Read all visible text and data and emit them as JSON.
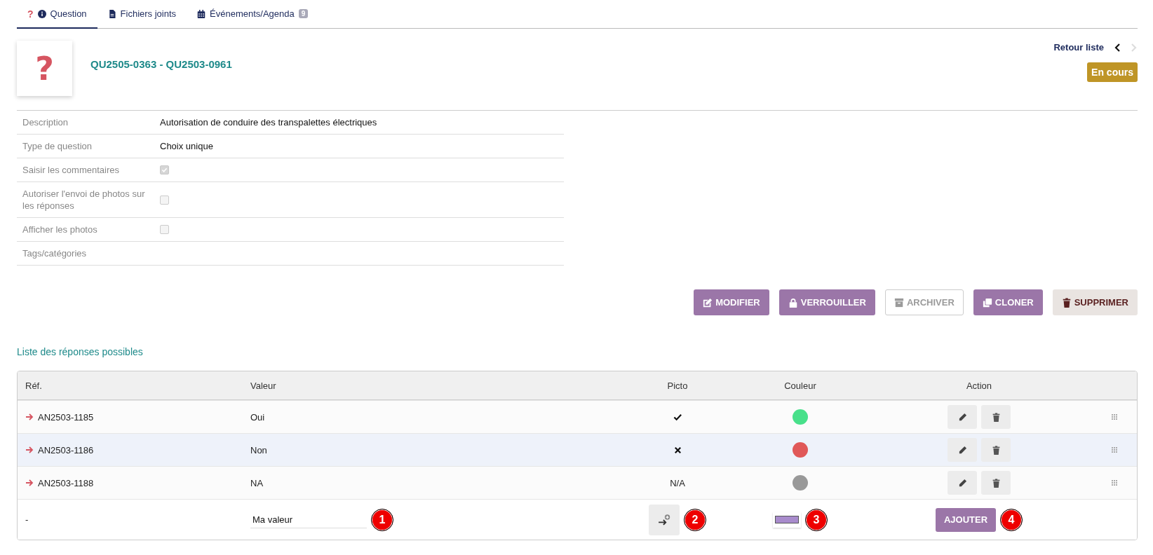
{
  "tabs": [
    {
      "label": "Question",
      "glyph": "?",
      "selected": true
    },
    {
      "label": "Fichiers joints",
      "selected": false
    },
    {
      "label": "Événements/Agenda",
      "badge": "9",
      "selected": false
    }
  ],
  "header": {
    "glyph": "?",
    "title": "QU2505-0363 - QU2503-0961",
    "back_link": "Retour liste",
    "status": "En cours",
    "prev_enabled": true,
    "next_enabled": false
  },
  "properties": [
    {
      "label": "Description",
      "kind": "text",
      "value": "Autorisation de conduire des transpalettes électriques"
    },
    {
      "label": "Type de question",
      "kind": "text",
      "value": "Choix unique"
    },
    {
      "label": "Saisir les commentaires",
      "kind": "checkbox",
      "checked": true
    },
    {
      "label": "Autoriser l'envoi de photos sur les réponses",
      "kind": "checkbox",
      "checked": false
    },
    {
      "label": "Afficher les photos",
      "kind": "checkbox",
      "checked": false
    },
    {
      "label": "Tags/catégories",
      "kind": "text"
    }
  ],
  "actions": [
    {
      "label": "MODIFIER",
      "kind": "primary"
    },
    {
      "label": "VERROUILLER",
      "kind": "primary"
    },
    {
      "label": "ARCHIVER",
      "kind": "disabled"
    },
    {
      "label": "CLONER",
      "kind": "primary"
    },
    {
      "label": "SUPPRIMER",
      "kind": "danger"
    }
  ],
  "answers": {
    "title": "Liste des réponses possibles",
    "columns": [
      "Réf.",
      "Valeur",
      "Picto",
      "Couleur",
      "Action"
    ],
    "rows": [
      {
        "ref": "AN2503-1185",
        "value": "Oui",
        "picto": {
          "kind": "check"
        },
        "color": "#48e08a",
        "highlighted": false
      },
      {
        "ref": "AN2503-1186",
        "value": "Non",
        "picto": {
          "kind": "cross"
        },
        "color": "#e05858",
        "highlighted": true
      },
      {
        "ref": "AN2503-1188",
        "value": "NA",
        "picto": {
          "kind": "text",
          "text": "N/A"
        },
        "color": "#999999",
        "highlighted": false
      }
    ],
    "new_row": {
      "ref": "-",
      "value": "Ma valeur",
      "value_marker": "1",
      "picto_marker": "2",
      "color": "#a88bcc",
      "color_marker": "3",
      "add_label": "AJOUTER",
      "add_marker": "4"
    }
  }
}
